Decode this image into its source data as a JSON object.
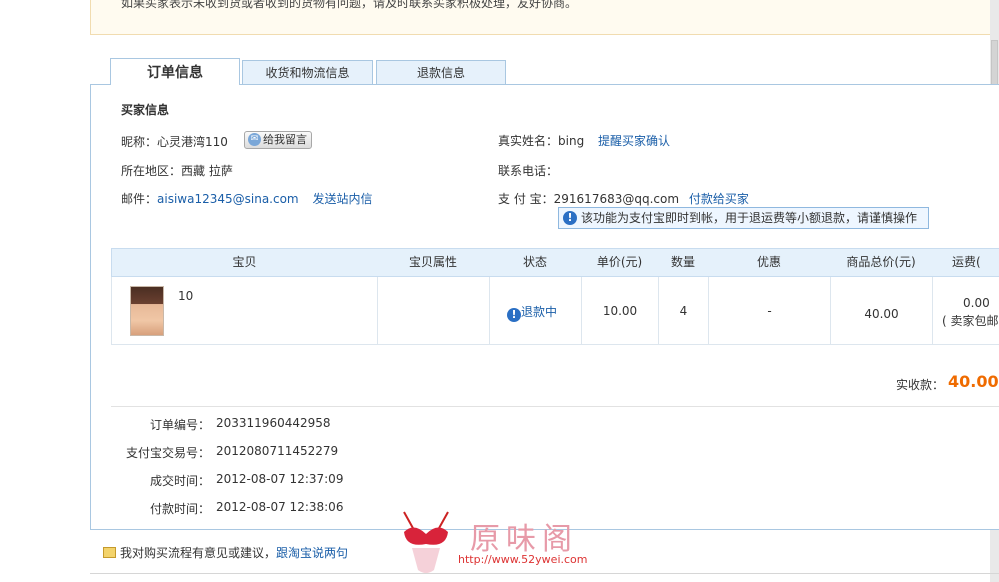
{
  "notice": {
    "text": "如果买家表示未收到货或者收到的货物有问题，请及时联系买家积极处理，友好协商。"
  },
  "tabs": [
    {
      "label": "订单信息",
      "active": true
    },
    {
      "label": "收货和物流信息",
      "active": false
    },
    {
      "label": "退款信息",
      "active": false
    }
  ],
  "buyer": {
    "section_title": "买家信息",
    "nickname_label": "昵称：",
    "nickname": "心灵港湾110",
    "message_button": "给我留言",
    "region_label": "所在地区：",
    "region": "西藏 拉萨",
    "email_label": "邮件：",
    "email": "aisiwa12345@sina.com",
    "send_message_link": "发送站内信",
    "realname_label": "真实姓名：",
    "realname": "bing",
    "remind_link": "提醒买家确认",
    "phone_label": "联系电话：",
    "phone": "",
    "alipay_label": "支 付 宝：",
    "alipay_account": "291617683@qq.com",
    "pay_to_buyer_link": "付款给买家",
    "tip": "该功能为支付宝即时到帐，用于退运费等小额退款，请谨慎操作"
  },
  "table": {
    "headers": [
      "宝贝",
      "宝贝属性",
      "状态",
      "单价(元)",
      "数量",
      "优惠",
      "商品总价(元)",
      "运费("
    ],
    "rows": [
      {
        "item_title": "10",
        "attributes": "",
        "status": "退款中",
        "unit_price": "10.00",
        "quantity": "4",
        "discount": "-",
        "total_price": "40.00",
        "shipping": "0.00",
        "shipping_note": "( 卖家包邮"
      }
    ]
  },
  "total": {
    "label": "实收款：",
    "value": "40.00"
  },
  "order_meta": [
    {
      "label": "订单编号：",
      "value": "203311960442958"
    },
    {
      "label": "支付宝交易号：",
      "value": "2012080711452279"
    },
    {
      "label": "成交时间：",
      "value": "2012-08-07 12:37:09"
    },
    {
      "label": "付款时间：",
      "value": "2012-08-07 12:38:06"
    }
  ],
  "feedback": {
    "text": "我对购买流程有意见或建议，",
    "link": "跟淘宝说两句"
  },
  "watermark": {
    "logo": "原味阁",
    "url": "http://www.52ywei.com"
  },
  "colors": {
    "accent_blue": "#1a5ea8",
    "total_orange": "#ef6b00",
    "tab_border": "#a9c7e1"
  }
}
